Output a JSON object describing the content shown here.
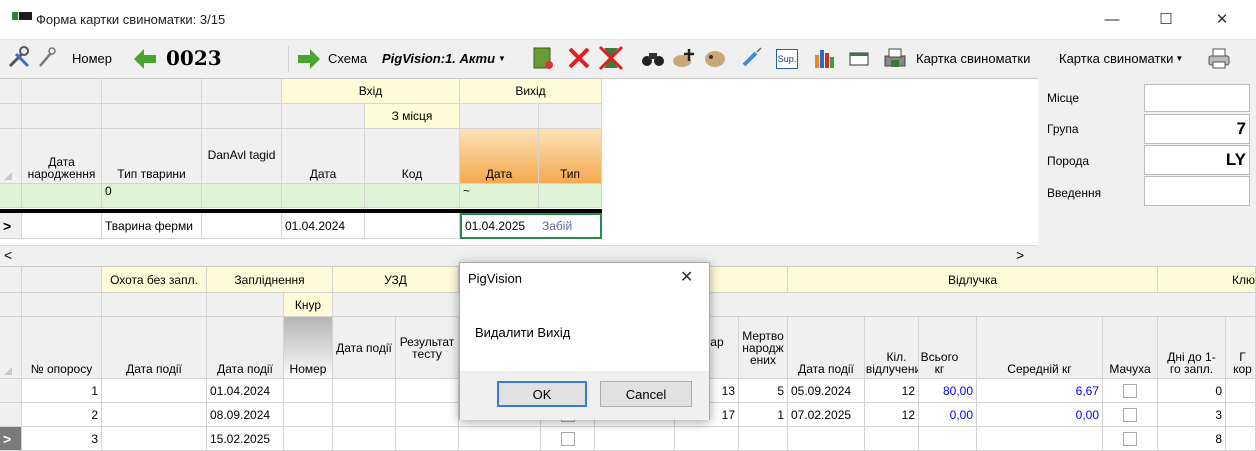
{
  "window": {
    "title": "Форма картки свиноматки: 3/15",
    "min_glyph": "—",
    "max_glyph": "☐",
    "close_glyph": "✕"
  },
  "toolbar": {
    "number_label": "Номер",
    "number_value": "0023",
    "scheme_label": "Схема",
    "scheme_combo_value": "PigVision:1. Акти",
    "sup_label": "Sup.",
    "card_label": "Картка свиноматки",
    "card_combo_value": "Картка свиноматки"
  },
  "right_panel": {
    "labels": [
      "Місце",
      "Група",
      "Порода",
      "Введення"
    ],
    "values": [
      "",
      "7",
      "LY",
      ""
    ]
  },
  "upper_grid": {
    "group_vhid": "Вхід",
    "group_z_mistsia": "З місця",
    "group_vykhid": "Вихід",
    "columns": [
      "Дата народження",
      "Тип тварини",
      "DanAvl tagid",
      "Дата",
      "Код",
      "Дата",
      "Тип"
    ],
    "filter": {
      "type": "0",
      "exit_date": "~"
    },
    "row": {
      "indicator": ">",
      "animal_type": "Тварина ферми",
      "entry_date": "01.04.2024",
      "exit_date": "01.04.2025",
      "exit_type": "Забій"
    },
    "scroll_left": "<",
    "scroll_right": ">"
  },
  "lower_grid": {
    "groups": {
      "heat": "Охота без запл.",
      "insem": "Запліднення",
      "boar": "Кнур",
      "uzd": "УЗД",
      "farrow": "с",
      "wean": "Відлучка",
      "key": "Клю"
    },
    "columns": {
      "parity": "№ опоросу",
      "event_date1": "Дата події",
      "event_date2": "Дата події",
      "number": "Номер",
      "uzd_date": "Дата події",
      "uzd_result": "Результат тесту",
      "born": "онар ж.",
      "dead": "Мертвонароджених",
      "wean_date": "Дата події",
      "wean_count": "Кіл. відлучених",
      "total_kg": "Всього кг",
      "avg_kg": "Середній кг",
      "nurse": "Мачуха",
      "days": "Дні до 1-го запл.",
      "extra": "Г кор"
    },
    "rows": [
      {
        "parity": "1",
        "insem_date": "01.04.2024",
        "born": "13",
        "dead": "5",
        "wean_date": "05.09.2024",
        "wean_count": "12",
        "total_kg": "80,00",
        "avg_kg": "6,67",
        "days": "0"
      },
      {
        "parity": "2",
        "insem_date": "08.09.2024",
        "born": "17",
        "dead": "1",
        "wean_date": "07.02.2025",
        "wean_count": "12",
        "total_kg": "0,00",
        "avg_kg": "0,00",
        "days": "3"
      },
      {
        "parity": "3",
        "insem_date": "15.02.2025",
        "born": "",
        "dead": "",
        "wean_date": "",
        "wean_count": "",
        "total_kg": "",
        "avg_kg": "",
        "days": "8"
      }
    ],
    "current_row_indicator": ">"
  },
  "dialog": {
    "title": "PigVision",
    "message": "Видалити Вихід",
    "ok": "OK",
    "cancel": "Cancel",
    "close_glyph": "✕"
  },
  "colors": {
    "yellow_header": "#fffbd8",
    "orange_header": "#f6a94d",
    "green_filter": "#dff3d6",
    "blue_value": "#0000ff",
    "exit_type_color": "#5b6ea5"
  }
}
